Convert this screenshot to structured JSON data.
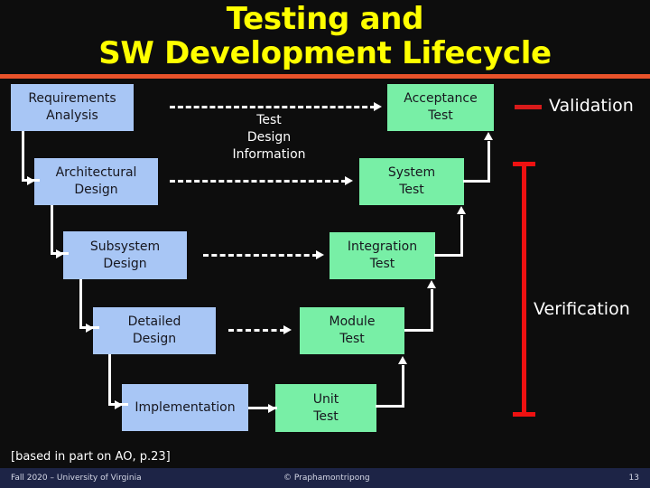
{
  "slide": {
    "title_line1": "Testing and",
    "title_line2": "SW Development Lifecycle",
    "title_color": "#ffff00",
    "rule_color": "#e8522a",
    "background_color": "#0d0d0d"
  },
  "diagram": {
    "dev_box_color": "#a8c6f5",
    "test_box_color": "#78efa6",
    "connector_color": "#ffffff",
    "info_flow_label": "Test\nDesign\nInformation",
    "development_boxes": [
      {
        "id": "requirements-analysis",
        "label": "Requirements\nAnalysis"
      },
      {
        "id": "architectural-design",
        "label": "Architectural\nDesign"
      },
      {
        "id": "subsystem-design",
        "label": "Subsystem\nDesign"
      },
      {
        "id": "detailed-design",
        "label": "Detailed\nDesign"
      },
      {
        "id": "implementation",
        "label": "Implementation"
      }
    ],
    "testing_boxes": [
      {
        "id": "acceptance-test",
        "label": "Acceptance\nTest"
      },
      {
        "id": "system-test",
        "label": "System\nTest"
      },
      {
        "id": "integration-test",
        "label": "Integration\nTest"
      },
      {
        "id": "module-test",
        "label": "Module\nTest"
      },
      {
        "id": "unit-test",
        "label": "Unit\nTest"
      }
    ]
  },
  "legend": {
    "validation_label": "Validation",
    "verification_label": "Verification",
    "validation_color": "#d71a1a",
    "verification_color": "#ee1111"
  },
  "source_note": "[based in part on AO, p.23]",
  "footer": {
    "left": "Fall 2020 – University of Virginia",
    "center": "© Praphamontripong",
    "page_number": "13",
    "background_color": "#1d2446"
  }
}
